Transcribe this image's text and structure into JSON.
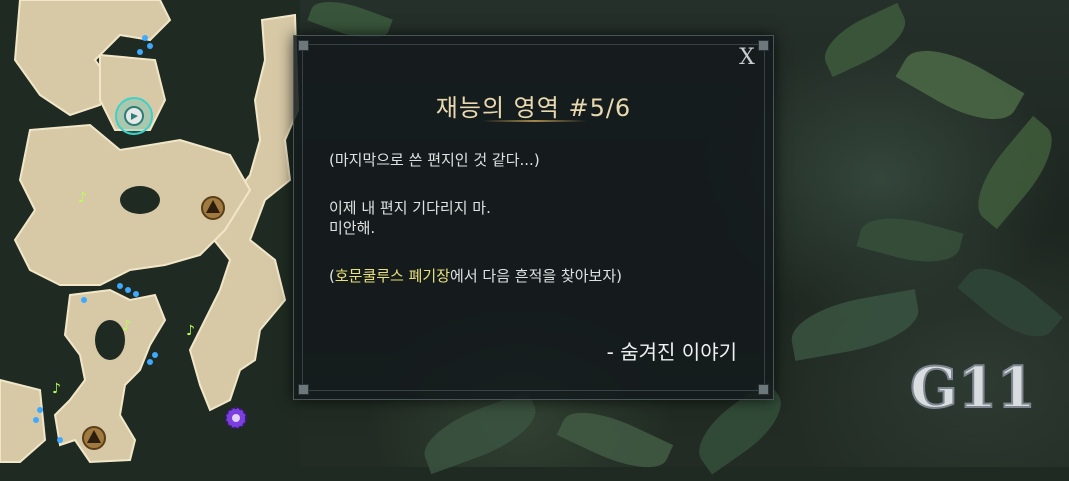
{
  "dialog": {
    "close_label": "X",
    "title": "재능의 영역 #5/6",
    "lines": {
      "line1": "(마지막으로 쓴 편지인 것 같다...)",
      "line2": "이제 내 편지 기다리지 마.",
      "line3": "미안해.",
      "hint_prefix": "(",
      "hint_location": "호문쿨루스 폐기장",
      "hint_suffix": "에서 다음 흔적을 찾아보자)"
    },
    "signature": "- 숨겨진 이야기"
  },
  "watermark": {
    "text": "G11"
  },
  "colors": {
    "title_gold": "#e8d9b0",
    "highlight_yellow": "#e8e07a",
    "map_land": "#d7c9a6",
    "map_border": "#f1e6c8"
  },
  "minimap": {
    "icons": [
      "player-location-icon",
      "triangle-marker-icon",
      "music-note-icon",
      "purple-gear-icon",
      "dotted-path"
    ]
  }
}
